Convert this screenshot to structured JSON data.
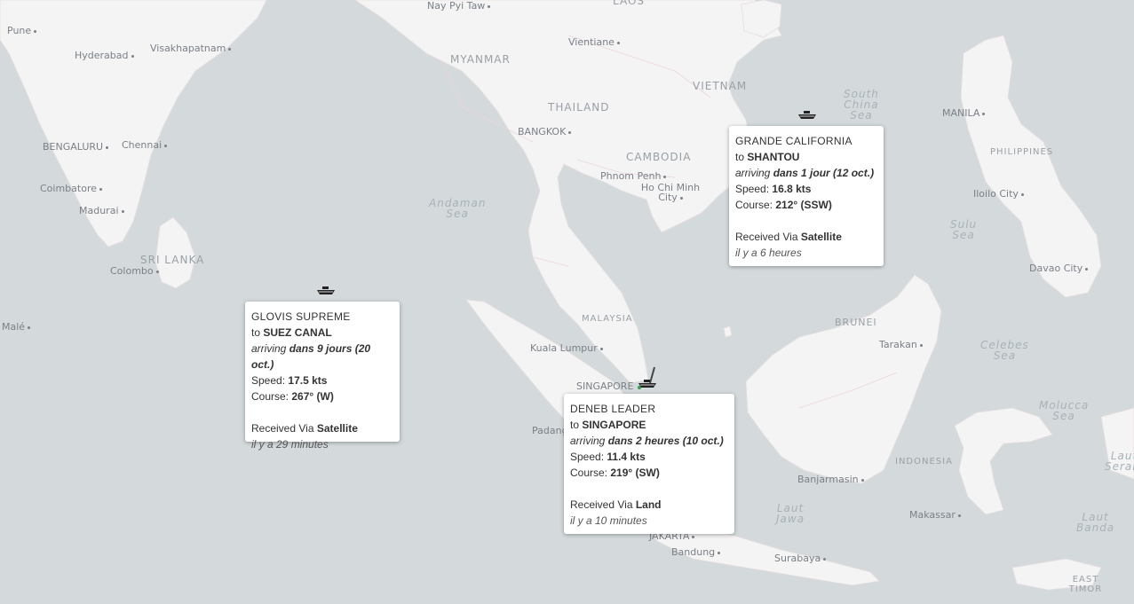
{
  "labels": {
    "cities": [
      "Pune",
      "Hyderabad",
      "Visakhapatnam",
      "BENGALURU",
      "Chennai",
      "Coimbatore",
      "Madurai",
      "Colombo",
      "Malé",
      "Nay Pyi Taw",
      "Vientiane",
      "BANGKOK",
      "Phnom Penh",
      "Ho Chi Minh City",
      "Kuala Lumpur",
      "SINGAPORE",
      "Padang",
      "JAKARTA",
      "Bandung",
      "Surabaya",
      "MANILA",
      "Iloilo City",
      "Davao City",
      "Tarakan",
      "Banjarmasin",
      "Makassar"
    ],
    "countries": [
      "MYANMAR",
      "THAILAND",
      "VIETNAM",
      "CAMBODIA",
      "LAOS",
      "SRI LANKA",
      "MALAYSIA",
      "PHILIPPINES",
      "BRUNEI",
      "INDONESIA",
      "EAST TIMOR"
    ],
    "seas": [
      "Andaman\nSea",
      "South\nChina\nSea",
      "Sulu\nSea",
      "Celebes\nSea",
      "Molucca\nSea",
      "Laut\nJawa",
      "Laut\nBanda",
      "Laut\nSeram"
    ]
  },
  "ships": [
    {
      "name": "GLOVIS SUPREME",
      "to_prefix": "to",
      "destination": "SUEZ CANAL",
      "arriving_prefix": "arriving",
      "eta": "dans 9 jours (20 oct.)",
      "speed_label": "Speed:",
      "speed": "17.5 kts",
      "course_label": "Course:",
      "course": "267° (W)",
      "received_label": "Received Via",
      "received_via": "Satellite",
      "ago": "il y a 29 minutes"
    },
    {
      "name": "DENEB LEADER",
      "to_prefix": "to",
      "destination": "SINGAPORE",
      "arriving_prefix": "arriving",
      "eta": "dans 2 heures (10 oct.)",
      "speed_label": "Speed:",
      "speed": "11.4 kts",
      "course_label": "Course:",
      "course": "219° (SW)",
      "received_label": "Received Via",
      "received_via": "Land",
      "ago": "il y a 10 minutes"
    },
    {
      "name": "GRANDE CALIFORNIA",
      "to_prefix": "to",
      "destination": "SHANTOU",
      "arriving_prefix": "arriving",
      "eta": "dans 1 jour (12 oct.)",
      "speed_label": "Speed:",
      "speed": "16.8 kts",
      "course_label": "Course:",
      "course": "212° (SSW)",
      "received_label": "Received Via",
      "received_via": "Satellite",
      "ago": "il y a 6 heures"
    }
  ],
  "colors": {
    "water": "#d4dadc",
    "land": "#f4f4f4",
    "border": "#e3c9d0",
    "ship": "#222222"
  },
  "icons": {
    "ship": "ship-icon",
    "track": "track-line"
  }
}
